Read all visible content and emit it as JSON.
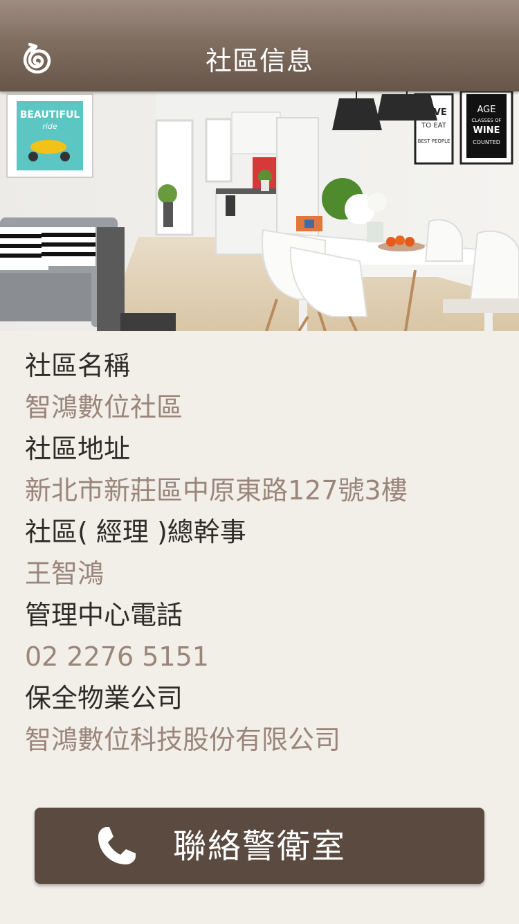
{
  "header": {
    "title": "社區信息",
    "back_icon": "swirl-back-icon"
  },
  "hero": {
    "description_icon": "interior-photo",
    "poster_left": {
      "line1": "BEAUTIFUL",
      "line2": "ride"
    },
    "poster_middle": {
      "line1": "LOVE",
      "line2": "TO EAT",
      "line3": "BEST PEOPLE"
    },
    "poster_right": {
      "line1": "AGE",
      "line2": "CLASSES OF",
      "line3": "WINE",
      "line4": "COUNTED"
    }
  },
  "info": {
    "name_label": "社區名稱",
    "name_value": "智鴻數位社區",
    "address_label": "社區地址",
    "address_value": "新北市新莊區中原東路127號3樓",
    "manager_label": "社區( 經理 )總幹事",
    "manager_value": "王智鴻",
    "phone_label": "管理中心電話",
    "phone_value": "02 2276 5151",
    "security_label": "保全物業公司",
    "security_value": "智鴻數位科技股份有限公司"
  },
  "call_button": {
    "label": "聯絡警衛室",
    "icon": "phone-icon"
  },
  "colors": {
    "header": "#806e61",
    "background": "#f2efe9",
    "label": "#2f2a27",
    "value": "#9a857a",
    "button": "#5a4a40"
  }
}
